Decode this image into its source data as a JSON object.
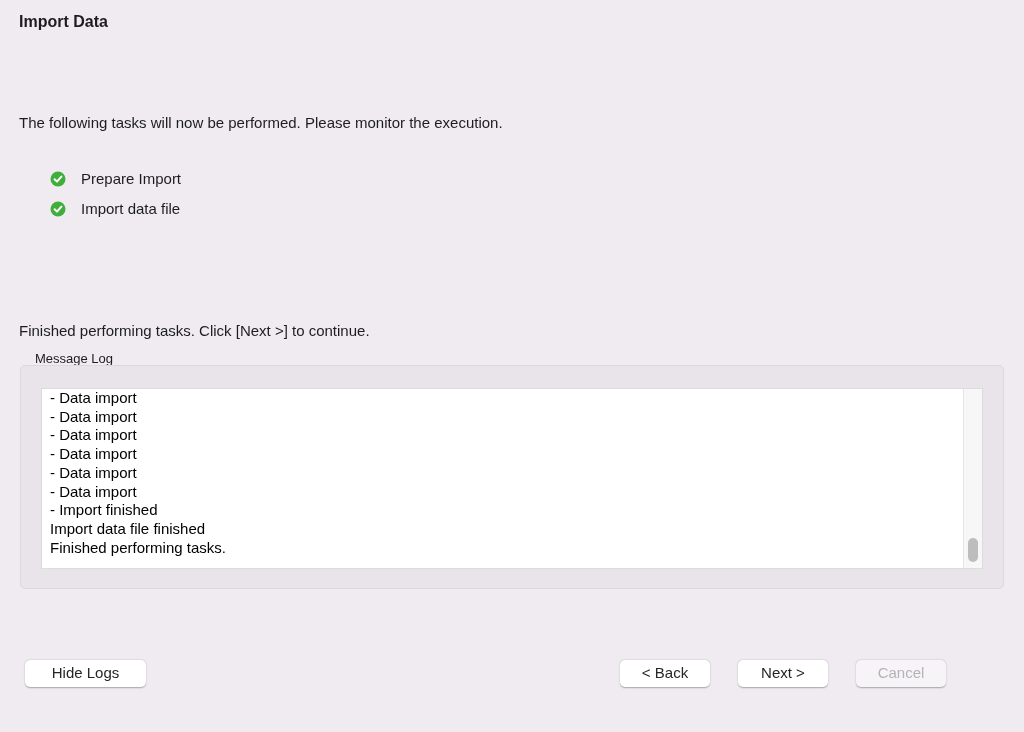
{
  "title": "Import Data",
  "intro": "The following tasks will now be performed. Please monitor the execution.",
  "tasks": [
    {
      "label": "Prepare Import",
      "done": true
    },
    {
      "label": "Import data file",
      "done": true
    }
  ],
  "status": "Finished performing tasks. Click [Next >] to continue.",
  "message_log": {
    "label": "Message Log",
    "lines": [
      "- Data import",
      "- Data import",
      "- Data import",
      "- Data import",
      "- Data import",
      "- Data import",
      "- Import finished",
      "Import data file finished",
      "Finished performing tasks."
    ]
  },
  "buttons": [
    {
      "label": "Hide Logs",
      "disabled": false
    },
    {
      "label": "< Back",
      "disabled": false
    },
    {
      "label": "Next >",
      "disabled": false
    },
    {
      "label": "Cancel",
      "disabled": true
    }
  ]
}
